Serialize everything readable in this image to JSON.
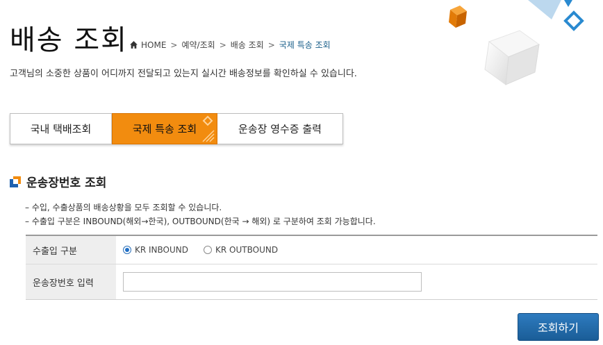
{
  "header": {
    "title": "배송 조회",
    "breadcrumb": [
      "HOME",
      "예약/조회",
      "배송 조회",
      "국제 특송 조회"
    ],
    "breadcrumb_sep": ">",
    "subtitle": "고객님의 소중한 상품이 어디까지 전달되고 있는지 실시간 배송정보를 확인하실 수 있습니다."
  },
  "tabs": [
    {
      "label": "국내 택배조회",
      "active": false
    },
    {
      "label": "국제 특송 조회",
      "active": true
    },
    {
      "label": "운송장 영수증 출력",
      "active": false
    }
  ],
  "section": {
    "title": "운송장번호 조회",
    "notes": [
      "– 수입, 수출상품의 배송상황을 모두 조회할 수 있습니다.",
      "– 수출입 구분은 INBOUND(해외→한국), OUTBOUND(한국 → 해외) 로 구분하여 조회 가능합니다."
    ]
  },
  "form": {
    "direction_label": "수출입 구분",
    "options": [
      {
        "label": "KR INBOUND",
        "selected": true
      },
      {
        "label": "KR OUTBOUND",
        "selected": false
      }
    ],
    "waybill_label": "운송장번호 입력",
    "waybill_value": ""
  },
  "actions": {
    "search_label": "조회하기"
  },
  "colors": {
    "accent_orange": "#f28c0f",
    "accent_blue": "#1f6fc6",
    "breadcrumb_current": "#1a5f8a"
  }
}
